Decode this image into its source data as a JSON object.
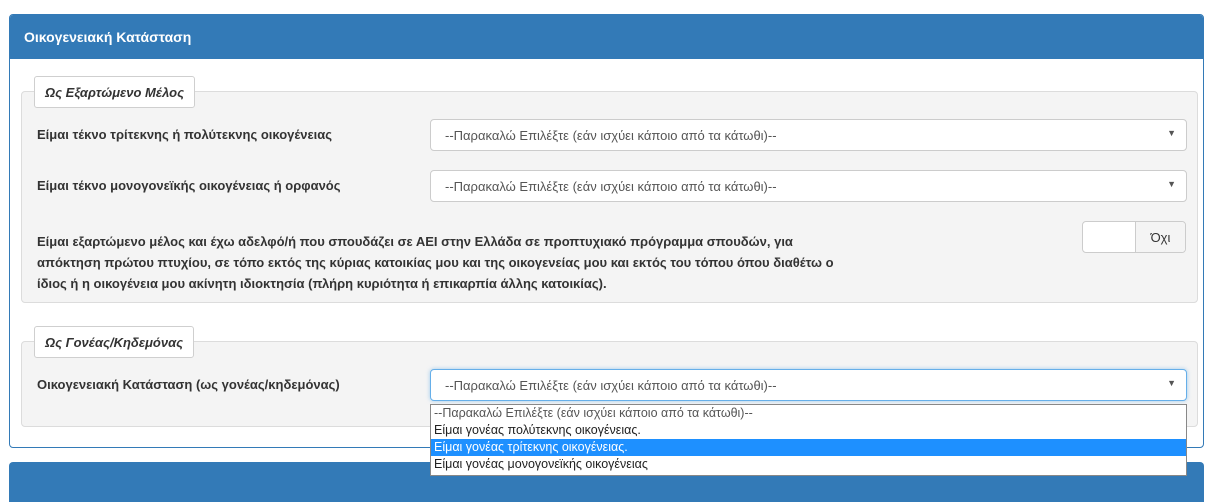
{
  "panel": {
    "title": "Οικογενειακή Κατάσταση"
  },
  "dependent_section": {
    "legend": "Ως Εξαρτώμενο Μέλος",
    "field1": {
      "label": "Είμαι τέκνο τρίτεκνης ή πολύτεκνης οικογένειας",
      "value": "--Παρακαλώ Επιλέξτε (εάν ισχύει κάποιο από τα κάτωθι)--"
    },
    "field2": {
      "label": "Είμαι τέκνο μονογονεϊκής οικογένειας ή ορφανός",
      "value": "--Παρακαλώ Επιλέξτε (εάν ισχύει κάποιο από τα κάτωθι)--"
    },
    "field3": {
      "label_line1": "Είμαι εξαρτώμενο μέλος και έχω αδελφό/ή που σπουδάζει σε ΑΕΙ στην Ελλάδα σε προπτυχιακό πρόγραμμα σπουδών, για",
      "label_line2": "απόκτηση πρώτου πτυχίου, σε τόπο εκτός της κύριας κατοικίας μου και της οικογενείας μου και εκτός του τόπου όπου διαθέτω ο",
      "label_line3": "ίδιος ή η οικογένεια μου ακίνητη ιδιοκτησία (πλήρη κυριότητα ή επικαρπία άλλης κατοικίας).",
      "toggle_state": "Όχι"
    }
  },
  "parent_section": {
    "legend": "Ως Γονέας/Κηδεμόνας",
    "field": {
      "label": "Οικογενειακή Κατάσταση (ως γονέας/κηδεμόνας)",
      "value": "--Παρακαλώ Επιλέξτε (εάν ισχύει κάποιο από τα κάτωθι)--"
    },
    "dropdown_options": [
      "--Παρακαλώ Επιλέξτε (εάν ισχύει κάποιο από τα κάτωθι)--",
      "Είμαι γονέας πολύτεκνης οικογένειας.",
      "Είμαι γονέας τρίτεκνης οικογένειας.",
      "Είμαι γονέας μονογονεϊκής οικογένειας"
    ],
    "highlighted_option_index": 2
  },
  "icons": {
    "select_arrow": "▼"
  },
  "colors": {
    "primary": "#337ab7",
    "highlight": "#1e90ff"
  }
}
